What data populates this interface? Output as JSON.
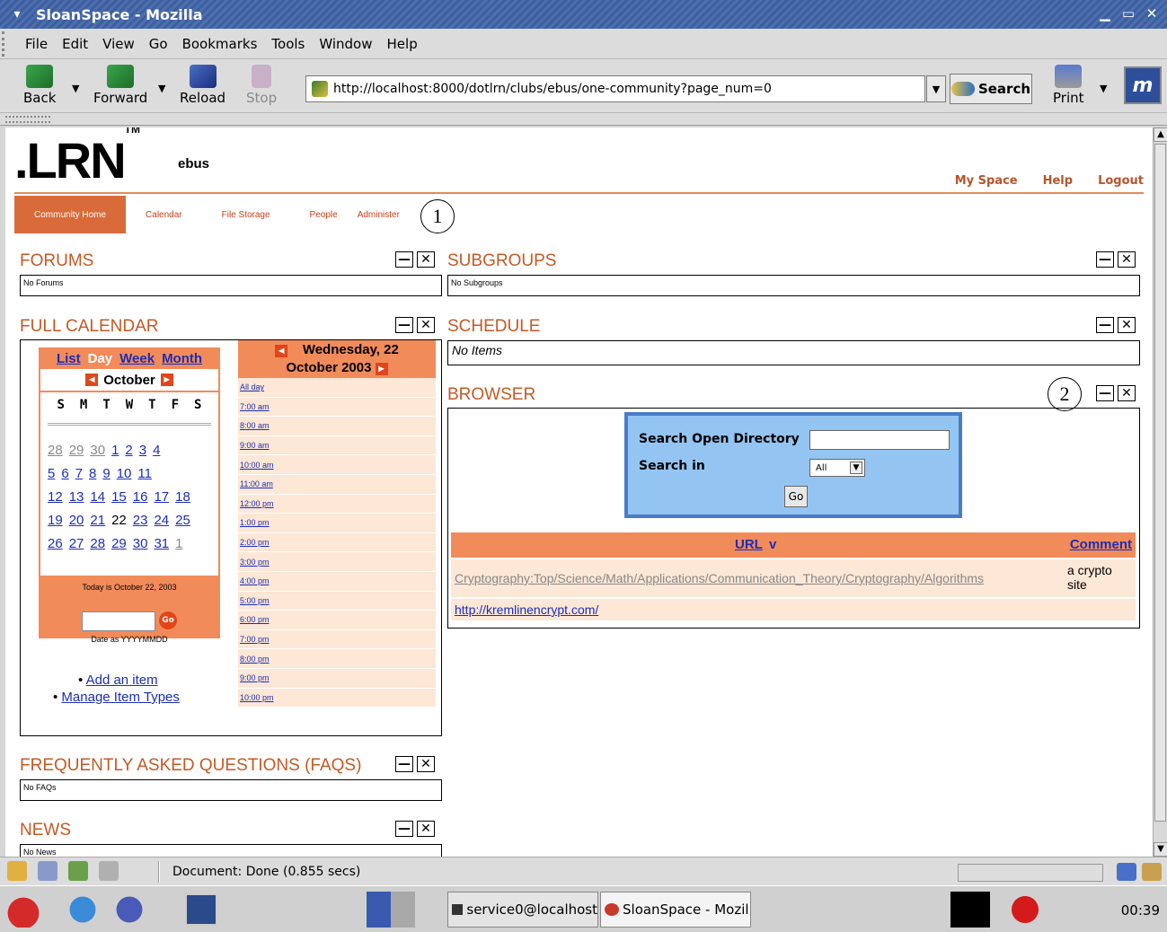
{
  "window": {
    "title": "SloanSpace - Mozilla",
    "menu_glyph": "▾",
    "buttons": {
      "minimize": "▁",
      "maximize": "▭",
      "close": "✕"
    }
  },
  "menubar": [
    "File",
    "Edit",
    "View",
    "Go",
    "Bookmarks",
    "Tools",
    "Window",
    "Help"
  ],
  "toolbar": {
    "back": "Back",
    "forward": "Forward",
    "reload": "Reload",
    "stop": "Stop",
    "url": "http://localhost:8000/dotlrn/clubs/ebus/one-community?page_num=0",
    "search": "Search",
    "print": "Print",
    "dropdown_glyph": "▼"
  },
  "page": {
    "logo": ".LRN",
    "logo_tm": "TM",
    "club": "ebus",
    "toplinks": [
      "My Space",
      "Help",
      "Logout"
    ],
    "tabs": [
      "Community Home",
      "Calendar",
      "File Storage",
      "People",
      "Administer"
    ],
    "callouts": [
      "1",
      "2"
    ],
    "portlets": {
      "forums": {
        "title": "FORUMS",
        "body": "No Forums"
      },
      "subgroups": {
        "title": "SUBGROUPS",
        "body": "No Subgroups"
      },
      "calendar": {
        "title": "FULL CALENDAR"
      },
      "schedule": {
        "title": "SCHEDULE",
        "body": "No Items"
      },
      "browser": {
        "title": "BROWSER"
      },
      "faqs": {
        "title": "FREQUENTLY ASKED QUESTIONS (FAQS)",
        "body": "No FAQs"
      },
      "news": {
        "title": "NEWS",
        "body": "No News"
      }
    },
    "portlet_controls": {
      "shade": "—",
      "close": "✕"
    }
  },
  "calendar": {
    "views": [
      "List",
      "Day",
      "Week",
      "Month"
    ],
    "current_view": "Day",
    "month": "October",
    "prev": "◄",
    "next": "►",
    "dow": [
      "S",
      "M",
      "T",
      "W",
      "T",
      "F",
      "S"
    ],
    "weeks": [
      [
        "28",
        "29",
        "30",
        "1",
        "2",
        "3",
        "4"
      ],
      [
        "5",
        "6",
        "7",
        "8",
        "9",
        "10",
        "11"
      ],
      [
        "12",
        "13",
        "14",
        "15",
        "16",
        "17",
        "18"
      ],
      [
        "19",
        "20",
        "21",
        "22",
        "23",
        "24",
        "25"
      ],
      [
        "26",
        "27",
        "28",
        "29",
        "30",
        "31",
        "1"
      ]
    ],
    "today_text": "Today is October 22, 2003",
    "go": "Go",
    "date_hint": "Date as YYYYMMDD",
    "links": [
      "Add an item",
      "Manage Item Types"
    ],
    "day_title_line1": "Wednesday, 22",
    "day_title_line2": "October 2003",
    "hours": [
      "All day",
      "7:00 am",
      "8:00 am",
      "9:00 am",
      "10:00 am",
      "11:00 am",
      "12:00 pm",
      "1:00 pm",
      "2:00 pm",
      "3:00 pm",
      "4:00 pm",
      "5:00 pm",
      "6:00 pm",
      "7:00 pm",
      "8:00 pm",
      "9:00 pm",
      "10:00 pm"
    ]
  },
  "browser": {
    "search_label": "Search Open Directory",
    "search_in_label": "Search in",
    "search_in_value": "All",
    "go": "Go",
    "col_url": "URL",
    "col_url_sort": "v",
    "col_comment": "Comment",
    "category": "Cryptography:Top/Science/Math/Applications/Communication_Theory/Cryptography/Algorithms",
    "comment": "a crypto site",
    "link": "http://kremlinencrypt.com/"
  },
  "status": {
    "text": "Document: Done (0.855 secs)"
  },
  "taskbar": {
    "tasks": [
      "service0@localhost",
      "SloanSpace - Mozil"
    ],
    "clock": "00:39"
  }
}
